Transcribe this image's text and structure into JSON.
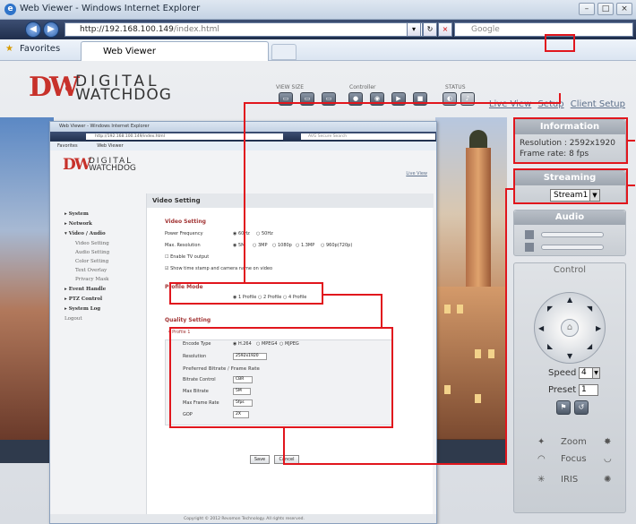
{
  "browser": {
    "window_title": "Web Viewer - Windows Internet Explorer",
    "address_host": "http://192.168.100.149",
    "address_path": "/index.html",
    "search_placeholder": "Google",
    "favorites_label": "Favorites",
    "tab_label": "Web Viewer"
  },
  "viewer": {
    "logo_top": "DIGITAL",
    "logo_bottom": "WATCHDOG",
    "logo_mark": "DW",
    "toolbar_labels": [
      "VIEW SIZE",
      "Controller",
      "STATUS"
    ],
    "links": [
      "Live View",
      "Setup",
      "Client Setup"
    ]
  },
  "right_panel": {
    "information": {
      "title": "Information",
      "resolution": "Resolution : 2592x1920",
      "frame_rate": "Frame rate: 8 fps"
    },
    "streaming": {
      "title": "Streaming",
      "stream": "Stream1"
    },
    "audio": {
      "title": "Audio"
    },
    "control": {
      "title": "Control",
      "speed_label": "Speed",
      "speed_value": "4",
      "preset_label": "Preset",
      "preset_value": "1",
      "zoom_label": "Zoom",
      "focus_label": "Focus",
      "iris_label": "IRIS"
    }
  },
  "inner": {
    "window_title": "Web Viewer - Windows Internet Explorer",
    "address": "http://192.168.100.149/index.html",
    "search_placeholder": "AVG Secure Search",
    "favorites_label": "Favorites",
    "tab_label": "Web Viewer",
    "logo_top": "DIGITAL",
    "logo_bottom": "WATCHDOG",
    "logo_mark": "DW",
    "live_view": "Live View",
    "sidebar": {
      "items": [
        "System",
        "Network",
        "Video / Audio",
        "Event Handle",
        "PTZ Control",
        "System Log",
        "Logout"
      ],
      "video_sub": [
        "Video Setting",
        "Audio Setting",
        "Color Setting",
        "Text Overlay",
        "Privacy Mask"
      ]
    },
    "main_title": "Video Setting",
    "video_setting": {
      "title": "Video Setting",
      "power_frequency_label": "Power Frequency",
      "power_frequency_options": [
        "60Hz",
        "50Hz"
      ],
      "max_resolution_label": "Max. Resolution",
      "max_resolution_options": [
        "5M",
        "3MP",
        "1080p",
        "1.3MP",
        "960p(720p)"
      ],
      "enable_tv_output": "Enable TV output",
      "show_timestamp": "Show time stamp and camera name on video"
    },
    "profile_mode": {
      "title": "Profile Mode",
      "options": [
        "1 Profile",
        "2 Profile",
        "4 Profile"
      ]
    },
    "quality_setting": {
      "title": "Quality Setting",
      "profile": "Profile 1",
      "encode_type_label": "Encode Type",
      "encode_options": [
        "H.264",
        "MPEG4",
        "MJPEG"
      ],
      "resolution_label": "Resolution",
      "resolution_value": "2592x1920",
      "bitrate_heading": "Preferred Bitrate / Frame Rate",
      "bitrate_control_label": "Bitrate Control",
      "bitrate_control_value": "CBR",
      "max_bitrate_label": "Max Bitrate",
      "max_bitrate_value": "5M",
      "max_frame_rate_label": "Max Frame Rate",
      "max_frame_rate_value": "5fps",
      "gop_label": "GOP",
      "gop_value": "2X"
    },
    "save_label": "Save",
    "cancel_label": "Cancel",
    "copyright": "Copyright © 2012 Revomon Technology. All rights reserved."
  },
  "colors": {
    "annotation_red": "#e1161d",
    "brand_red": "#c7312a"
  }
}
